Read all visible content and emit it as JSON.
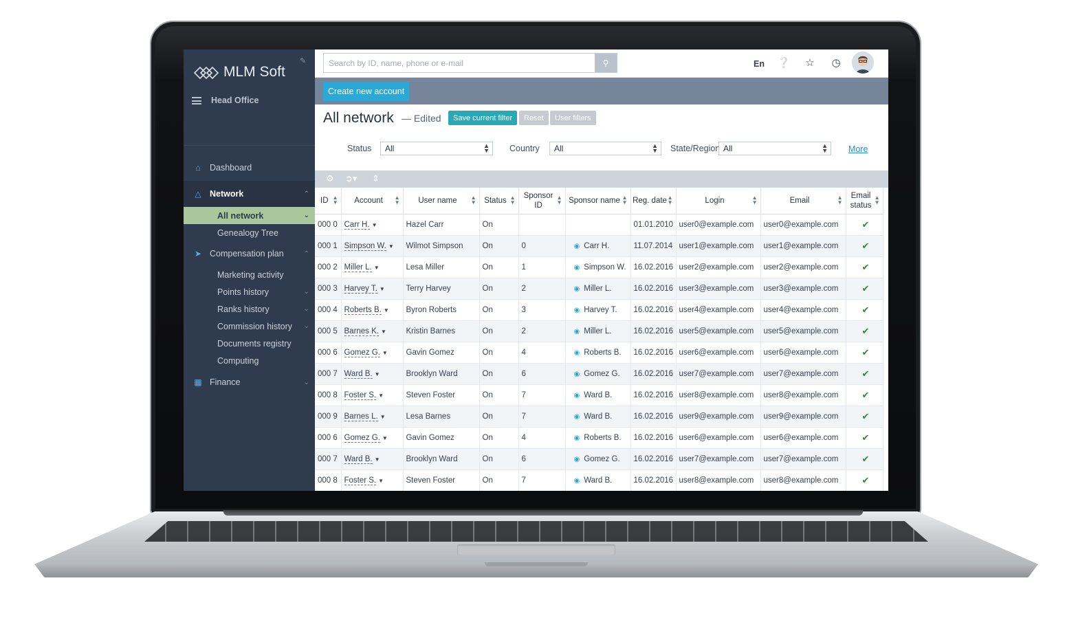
{
  "app": {
    "logo_text": "MLM Soft",
    "office": "Head Office"
  },
  "sidebar": {
    "items": [
      {
        "label": "Dashboard",
        "icon": "home-icon"
      },
      {
        "label": "Network",
        "icon": "network-icon"
      },
      {
        "label": "Compensation plan",
        "icon": "rocket-icon"
      },
      {
        "label": "Finance",
        "icon": "calculator-icon"
      }
    ],
    "network_sub": [
      "All network",
      "Genealogy Tree"
    ],
    "comp_sub": [
      "Marketing activity",
      "Points history",
      "Ranks history",
      "Commission history",
      "Documents registry",
      "Computing"
    ]
  },
  "search": {
    "placeholder": "Search by ID, name, phone or e-mail"
  },
  "topbar": {
    "lang": "En"
  },
  "actions": {
    "create_label": "Create new account"
  },
  "page": {
    "title": "All network",
    "edited": "— Edited",
    "save_filter": "Save current filter",
    "reset": "Reset",
    "user_filters": "User filters"
  },
  "filters": {
    "status_label": "Status",
    "status_value": "All",
    "country_label": "Country",
    "country_value": "All",
    "region_label": "State/Region",
    "region_value": "All",
    "more": "More"
  },
  "table": {
    "headers": [
      "ID",
      "Account",
      "User name",
      "Status",
      "Sponsor ID",
      "Sponsor name",
      "Reg. date",
      "Login",
      "Email",
      "Email status"
    ],
    "rows": [
      [
        "000 0",
        "Carr H.",
        "Hazel Carr",
        "On",
        "",
        "",
        "01.01.2010",
        "user0@example.com",
        "user0@example.com"
      ],
      [
        "000 1",
        "Simpson W.",
        "Wilmot Simpson",
        "On",
        "0",
        "Carr H.",
        "11.07.2014",
        "user1@example.com",
        "user1@example.com"
      ],
      [
        "000 2",
        "Miller L.",
        "Lesa Miller",
        "On",
        "1",
        "Simpson W.",
        "16.02.2016",
        "user2@example.com",
        "user2@example.com"
      ],
      [
        "000 3",
        "Harvey T.",
        "Terry Harvey",
        "On",
        "2",
        "Miller L.",
        "16.02.2016",
        "user3@example.com",
        "user3@example.com"
      ],
      [
        "000 4",
        "Roberts B.",
        "Byron Roberts",
        "On",
        "3",
        "Harvey T.",
        "16.02.2016",
        "user4@example.com",
        "user4@example.com"
      ],
      [
        "000 5",
        "Barnes K.",
        "Kristin Barnes",
        "On",
        "2",
        "Miller L.",
        "16.02.2016",
        "user5@example.com",
        "user5@example.com"
      ],
      [
        "000 6",
        "Gomez G.",
        "Gavin Gomez",
        "On",
        "4",
        "Roberts B.",
        "16.02.2016",
        "user6@example.com",
        "user6@example.com"
      ],
      [
        "000 7",
        "Ward B.",
        "Brooklyn Ward",
        "On",
        "6",
        "Gomez G.",
        "16.02.2016",
        "user7@example.com",
        "user7@example.com"
      ],
      [
        "000 8",
        "Foster S.",
        "Steven Foster",
        "On",
        "7",
        "Ward B.",
        "16.02.2016",
        "user8@example.com",
        "user8@example.com"
      ],
      [
        "000 9",
        "Barnes L.",
        "Lesa Barnes",
        "On",
        "7",
        "Ward B.",
        "16.02.2016",
        "user9@example.com",
        "user9@example.com"
      ],
      [
        "000 6",
        "Gomez G.",
        "Gavin Gomez",
        "On",
        "4",
        "Roberts B.",
        "16.02.2016",
        "user6@example.com",
        "user6@example.com"
      ],
      [
        "000 7",
        "Ward B.",
        "Brooklyn Ward",
        "On",
        "6",
        "Gomez G.",
        "16.02.2016",
        "user7@example.com",
        "user7@example.com"
      ],
      [
        "000 8",
        "Foster S.",
        "Steven Foster",
        "On",
        "7",
        "Ward B.",
        "16.02.2016",
        "user8@example.com",
        "user8@example.com"
      ]
    ]
  },
  "colors": {
    "sidebar_bg": "#2f3b4e",
    "accent": "#2aa9d6",
    "selected": "#a9c79b",
    "action_bar": "#76859a"
  }
}
